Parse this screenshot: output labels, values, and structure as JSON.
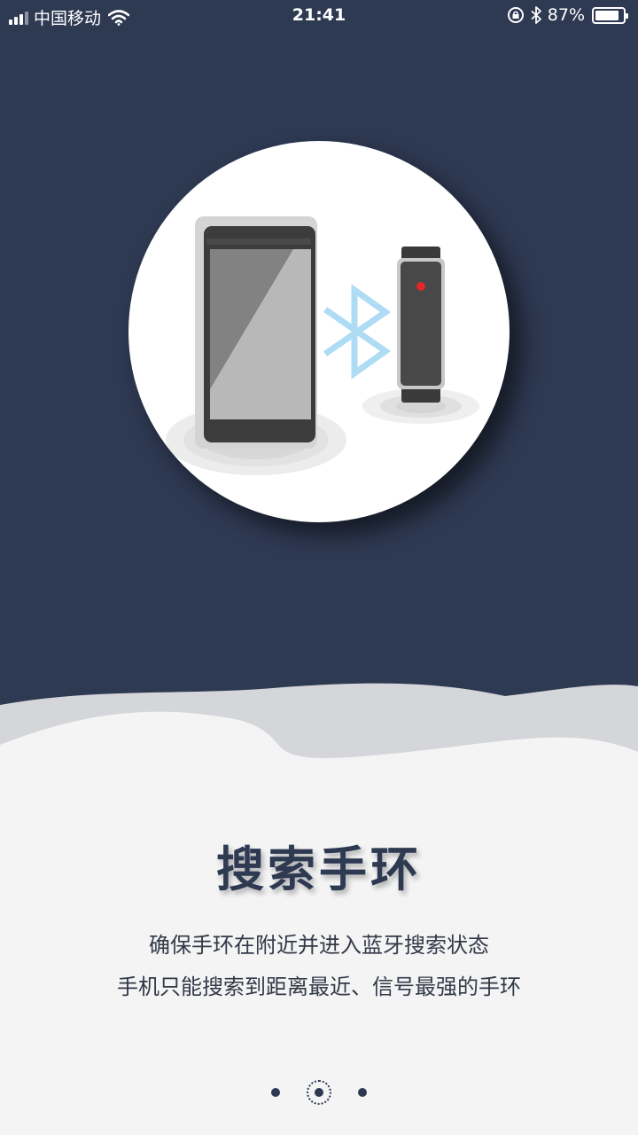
{
  "status_bar": {
    "carrier": "中国移动",
    "time": "21:41",
    "battery_percent": "87%",
    "battery_level": 0.87,
    "icons": [
      "signal-icon",
      "wifi-icon",
      "rotation-lock-icon",
      "bluetooth-icon",
      "battery-icon"
    ]
  },
  "onboarding": {
    "title": "搜索手环",
    "description_lines": [
      "确保手环在附近并进入蓝牙搜索状态",
      "手机只能搜索到距离最近、信号最强的手环"
    ],
    "page_count": 3,
    "current_page": 2
  },
  "colors": {
    "header_bg": "#2e3952",
    "content_bg": "#f4f4f5",
    "bluetooth_accent": "#aedcf5",
    "indicator_led": "#e0282a"
  }
}
